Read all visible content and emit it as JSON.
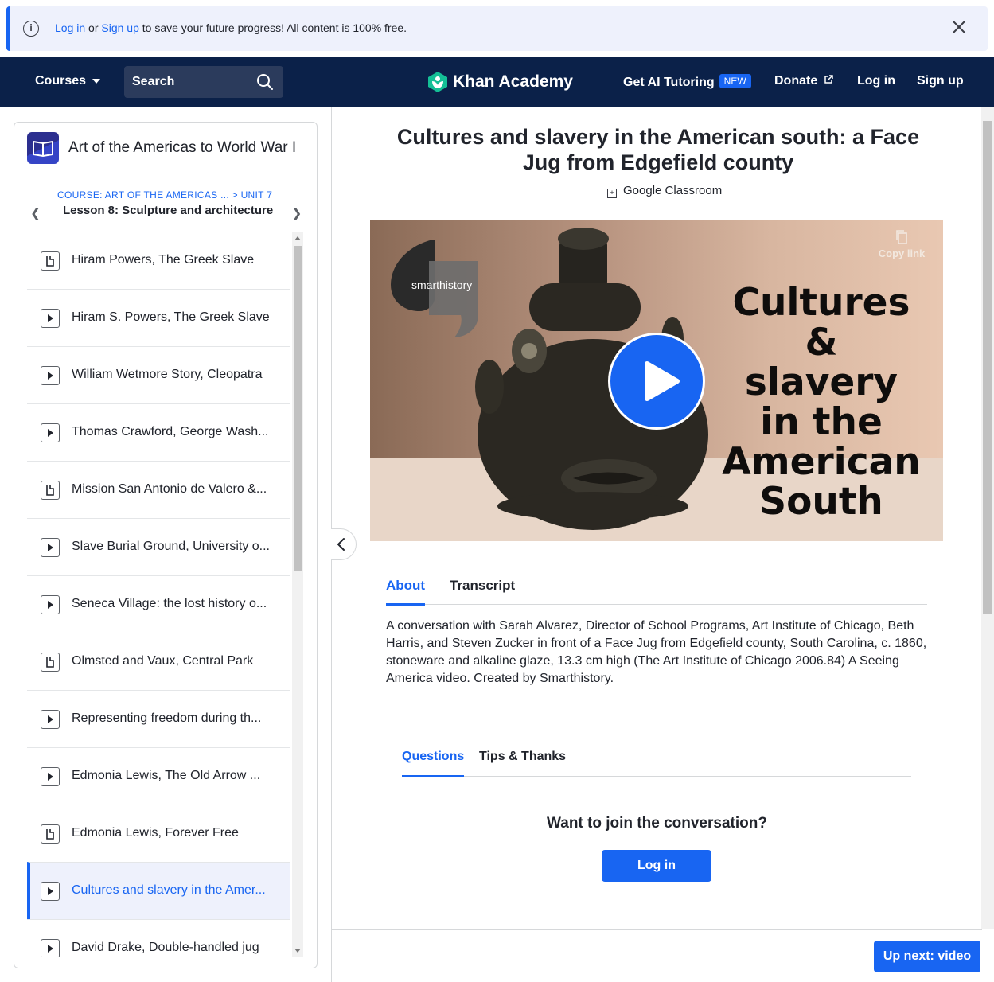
{
  "banner": {
    "login_link": "Log in",
    "or_text": " or ",
    "signup_link": "Sign up",
    "message": " to save your future progress! All content is 100% free."
  },
  "nav": {
    "courses": "Courses",
    "search_placeholder": "Search",
    "brand": "Khan Academy",
    "ai_tutoring": "Get AI Tutoring",
    "new_badge": "NEW",
    "donate": "Donate",
    "login": "Log in",
    "signup": "Sign up"
  },
  "sidebar": {
    "course_title": "Art of the Americas to World War I",
    "breadcrumb_course": "COURSE: ART OF THE AMERICAS ...",
    "breadcrumb_sep": " > ",
    "breadcrumb_unit": "UNIT 7",
    "lesson_title": "Lesson 8: Sculpture and architecture",
    "items": [
      {
        "label": "Hiram Powers, The Greek Slave",
        "type": "article"
      },
      {
        "label": "Hiram S. Powers, The Greek Slave",
        "type": "video"
      },
      {
        "label": "William Wetmore Story, Cleopatra",
        "type": "video"
      },
      {
        "label": "Thomas Crawford, George Wash...",
        "type": "video"
      },
      {
        "label": "Mission San Antonio de Valero &...",
        "type": "article"
      },
      {
        "label": "Slave Burial Ground, University o...",
        "type": "video"
      },
      {
        "label": "Seneca Village: the lost history o...",
        "type": "video"
      },
      {
        "label": "Olmsted and Vaux, Central Park",
        "type": "article"
      },
      {
        "label": "Representing freedom during th...",
        "type": "video"
      },
      {
        "label": "Edmonia Lewis, The Old Arrow ...",
        "type": "video"
      },
      {
        "label": "Edmonia Lewis, Forever Free",
        "type": "article"
      },
      {
        "label": "Cultures and slavery in the Amer...",
        "type": "video",
        "active": true
      },
      {
        "label": "David Drake, Double-handled jug",
        "type": "video"
      }
    ]
  },
  "main": {
    "title": "Cultures and slavery in the American south: a Face Jug from Edgefield county",
    "google_classroom": "Google Classroom",
    "video": {
      "brand": "smarthistory",
      "copy_link": "Copy link",
      "overlay_lines": [
        "Cultures &",
        "slavery",
        "in the",
        "American",
        "South"
      ]
    },
    "tabs": [
      "About",
      "Transcript"
    ],
    "about_text": "A conversation with Sarah Alvarez, Director of School Programs, Art Institute of Chicago, Beth Harris, and Steven Zucker in front of a Face Jug from Edgefield county, South Carolina, c. 1860, stoneware and alkaline glaze, 13.3 cm high (The Art Institute of Chicago 2006.84) A Seeing America video. Created by Smarthistory.",
    "discussion_tabs": [
      "Questions",
      "Tips & Thanks"
    ],
    "join_prompt": "Want to join the conversation?",
    "login_button": "Log in",
    "up_next": "Up next: video"
  },
  "colors": {
    "accent": "#1865f2",
    "nav_bg": "#0b2149",
    "banner_bg": "#eef1fc",
    "brand_green": "#14bf96"
  }
}
